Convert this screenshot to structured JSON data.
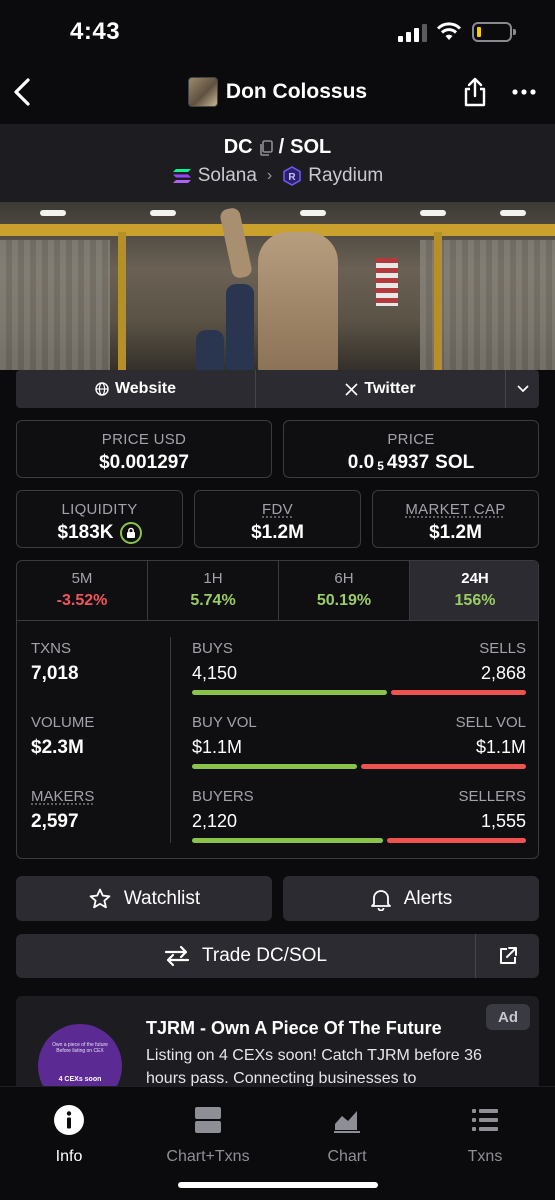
{
  "status_bar": {
    "time": "4:43"
  },
  "header": {
    "token_name": "Don Colossus"
  },
  "pair": {
    "base": "DC",
    "separator": "/",
    "quote": "SOL",
    "chain": "Solana",
    "dex": "Raydium"
  },
  "links": {
    "website": "Website",
    "twitter": "Twitter"
  },
  "price": {
    "usd_label": "PRICE USD",
    "usd_value": "$0.001297",
    "native_label": "PRICE",
    "native_prefix": "0.0",
    "native_zeros": "5",
    "native_digits": "4937",
    "native_unit": "SOL"
  },
  "liquidity": {
    "label": "LIQUIDITY",
    "value": "$183K"
  },
  "fdv": {
    "label": "FDV",
    "value": "$1.2M"
  },
  "market_cap": {
    "label": "MARKET CAP",
    "value": "$1.2M"
  },
  "timeframes": [
    {
      "label": "5M",
      "change": "-3.52%"
    },
    {
      "label": "1H",
      "change": "5.74%"
    },
    {
      "label": "6H",
      "change": "50.19%"
    },
    {
      "label": "24H",
      "change": "156%"
    }
  ],
  "stats": {
    "txns": {
      "label": "TXNS",
      "value": "7,018"
    },
    "volume": {
      "label": "VOLUME",
      "value": "$2.3M"
    },
    "makers": {
      "label": "MAKERS",
      "value": "2,597"
    },
    "buys": {
      "left_label": "BUYS",
      "left_value": "4,150",
      "right_label": "SELLS",
      "right_value": "2,868",
      "buy_fraction": 0.591
    },
    "vol_split": {
      "left_label": "BUY VOL",
      "left_value": "$1.1M",
      "right_label": "SELL VOL",
      "right_value": "$1.1M",
      "buy_fraction": 0.5
    },
    "buyers": {
      "left_label": "BUYERS",
      "left_value": "2,120",
      "right_label": "SELLERS",
      "right_value": "1,555",
      "buy_fraction": 0.577
    }
  },
  "actions": {
    "watchlist": "Watchlist",
    "alerts": "Alerts",
    "trade": "Trade DC/SOL"
  },
  "ad": {
    "badge": "Ad",
    "title": "TJRM - Own A Piece Of The Future",
    "body": "Listing on 4 CEXs soon! Catch TJRM before 36 hours pass. Connecting businesses to",
    "logo_text": "Own a piece of the future Before listing on CEX",
    "logo_cta": "4 CEXs soon"
  },
  "tabbar": [
    {
      "label": "Info",
      "icon": "info-icon",
      "active": true
    },
    {
      "label": "Chart+Txns",
      "icon": "chart-txns-icon",
      "active": false
    },
    {
      "label": "Chart",
      "icon": "area-chart-icon",
      "active": false
    },
    {
      "label": "Txns",
      "icon": "list-icon",
      "active": false
    }
  ],
  "colors": {
    "positive": "#9ccc65",
    "negative": "#f0555a",
    "buy_bar": "#8bc34a",
    "sell_bar": "#ef5350",
    "background": "#0b0b0d",
    "panel": "#1c1c21"
  }
}
